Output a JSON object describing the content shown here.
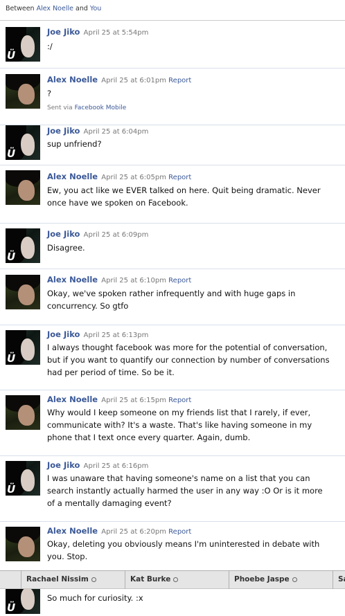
{
  "header": {
    "prefix": "Between",
    "participant": "Alex Noelle",
    "conj": "and",
    "self": "You"
  },
  "report_label": "Report",
  "sent_via": {
    "prefix": "Sent via",
    "link": "Facebook Mobile"
  },
  "messages": [
    {
      "author": "Joe Jiko",
      "time": "April 25 at 5:54pm",
      "text": ":/"
    },
    {
      "author": "Alex Noelle",
      "time": "April 25 at 6:01pm",
      "text": "?"
    },
    {
      "author": "Joe Jiko",
      "time": "April 25 at 6:04pm",
      "text": "sup unfriend?"
    },
    {
      "author": "Alex Noelle",
      "time": "April 25 at 6:05pm",
      "text": "Ew, you act like we EVER talked on here. Quit being dramatic. Never once have we spoken on Facebook."
    },
    {
      "author": "Joe Jiko",
      "time": "April 25 at 6:09pm",
      "text": "Disagree."
    },
    {
      "author": "Alex Noelle",
      "time": "April 25 at 6:10pm",
      "text": "Okay, we've spoken rather infrequently and with huge gaps in concurrency. So gtfo"
    },
    {
      "author": "Joe Jiko",
      "time": "April 25 at 6:13pm",
      "text": "I always thought facebook was more for the potential of conversation, but if you want to quantify our connection by number of conversations had per period of time. So be it."
    },
    {
      "author": "Alex Noelle",
      "time": "April 25 at 6:15pm",
      "text": "Why would I keep someone on my friends list that I rarely, if ever, communicate with? It's a waste. That's like having someone in my phone that I text once every quarter. Again, dumb."
    },
    {
      "author": "Joe Jiko",
      "time": "April 25 at 6:16pm",
      "text": "I was unaware that having someone's name on a list that you can search instantly actually harmed the user in any way :O Or is it more of a mentally damaging event?"
    },
    {
      "author": "Alex Noelle",
      "time": "April 25 at 6:20pm",
      "text": "Okay, deleting you obviously means I'm uninterested in debate with you. Stop."
    }
  ],
  "last_message": {
    "text": "So much for curiosity. :x"
  },
  "chat_tabs": [
    {
      "name": "Rachael Nissim"
    },
    {
      "name": "Kat Burke"
    },
    {
      "name": "Phoebe Jaspe"
    },
    {
      "name": "Sa"
    }
  ]
}
